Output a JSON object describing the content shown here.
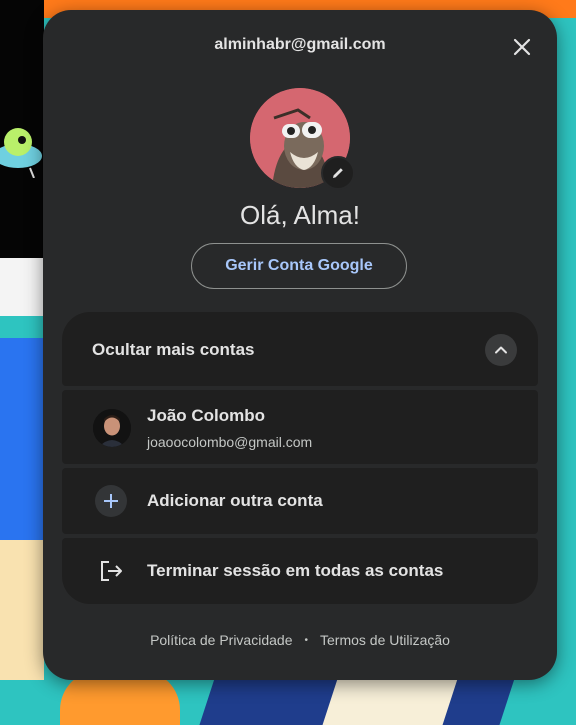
{
  "account": {
    "email": "alminhabr@gmail.com",
    "greeting": "Olá, Alma!",
    "manage_button": "Gerir Conta Google"
  },
  "other_accounts": {
    "toggle_label": "Ocultar mais contas",
    "accounts": [
      {
        "name": "João Colombo",
        "email": "joaoocolombo@gmail.com"
      }
    ],
    "add_account_label": "Adicionar outra conta",
    "sign_out_all_label": "Terminar sessão em todas as contas"
  },
  "footer": {
    "privacy": "Política de Privacidade",
    "separator": "•",
    "terms": "Termos de Utilização"
  },
  "icons": {
    "close": "close-icon",
    "edit": "pencil-icon",
    "collapse": "chevron-up-icon",
    "add": "plus-icon",
    "sign_out": "sign-out-icon"
  },
  "colors": {
    "panel_bg": "#28292a",
    "row_bg": "#1f1f1f",
    "accent_link": "#a8c7fa",
    "text_primary": "#e3e3e3",
    "text_secondary": "#c4c7c5"
  }
}
